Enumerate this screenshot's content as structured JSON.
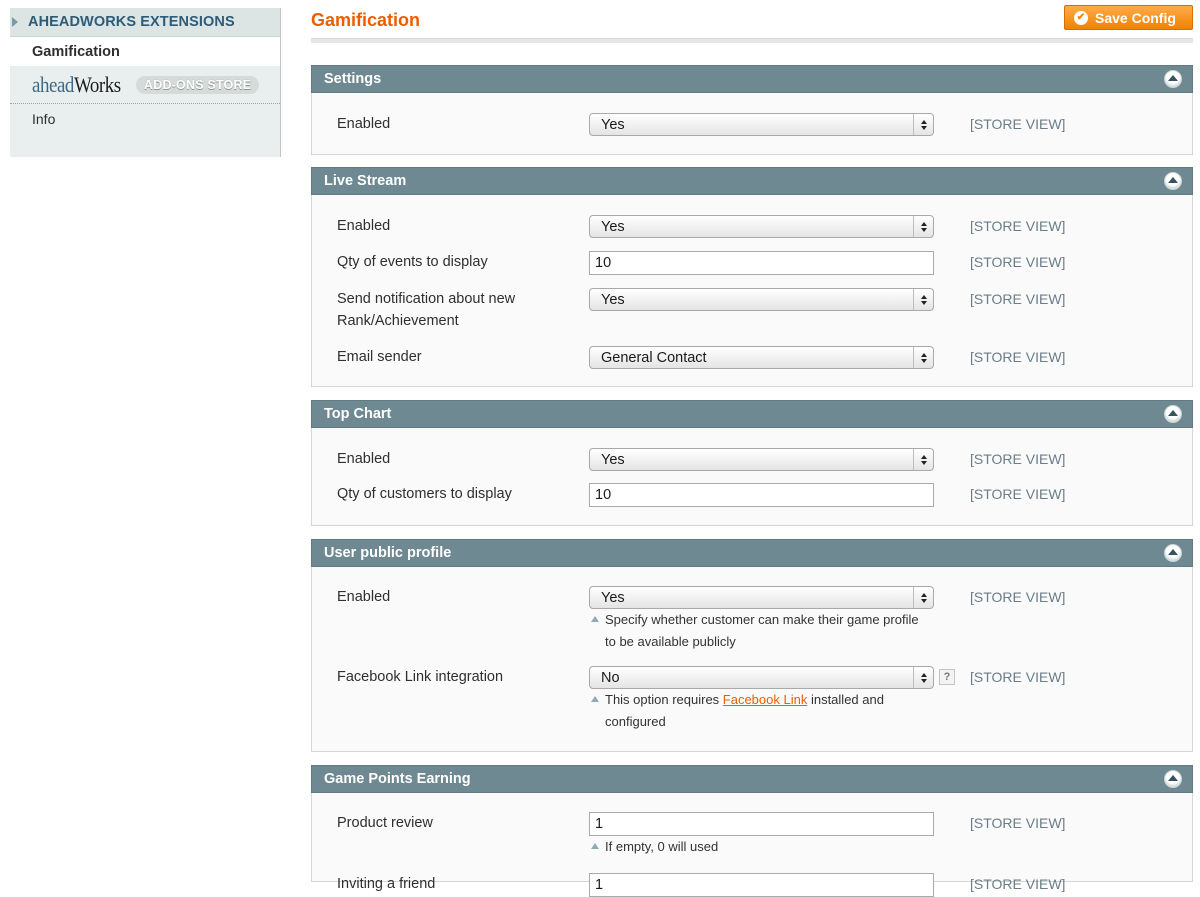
{
  "sidebar": {
    "group_label": "AHEADWORKS EXTENSIONS",
    "active_item": "Gamification",
    "logo_text_a": "ahead",
    "logo_text_b": "Works",
    "store_badge": "ADD-ONS STORE",
    "info_item": "Info"
  },
  "header": {
    "title": "Gamification",
    "save_label": "Save Config"
  },
  "scope_label": "[STORE VIEW]",
  "sections": {
    "settings": {
      "title": "Settings",
      "enabled_label": "Enabled",
      "enabled_value": "Yes"
    },
    "live_stream": {
      "title": "Live Stream",
      "enabled_label": "Enabled",
      "enabled_value": "Yes",
      "qty_label": "Qty of events to display",
      "qty_value": "10",
      "notify_label_1": "Send notification about new",
      "notify_label_2": "Rank/Achievement",
      "notify_value": "Yes",
      "sender_label": "Email sender",
      "sender_value": "General Contact"
    },
    "top_chart": {
      "title": "Top Chart",
      "enabled_label": "Enabled",
      "enabled_value": "Yes",
      "qty_label": "Qty of customers to display",
      "qty_value": "10"
    },
    "user_profile": {
      "title": "User public profile",
      "enabled_label": "Enabled",
      "enabled_value": "Yes",
      "enabled_note_1": "Specify whether customer can make their game profile",
      "enabled_note_2": "to be available publicly",
      "fb_label": "Facebook Link integration",
      "fb_value": "No",
      "fb_note_pre": "This option requires ",
      "fb_note_link": "Facebook Link",
      "fb_note_post": " installed and",
      "fb_note_2": "configured",
      "help_glyph": "?"
    },
    "points": {
      "title": "Game Points Earning",
      "review_label": "Product review",
      "review_value": "1",
      "review_note": "If empty, 0 will used",
      "invite_label": "Inviting a friend",
      "invite_value": "1"
    }
  }
}
